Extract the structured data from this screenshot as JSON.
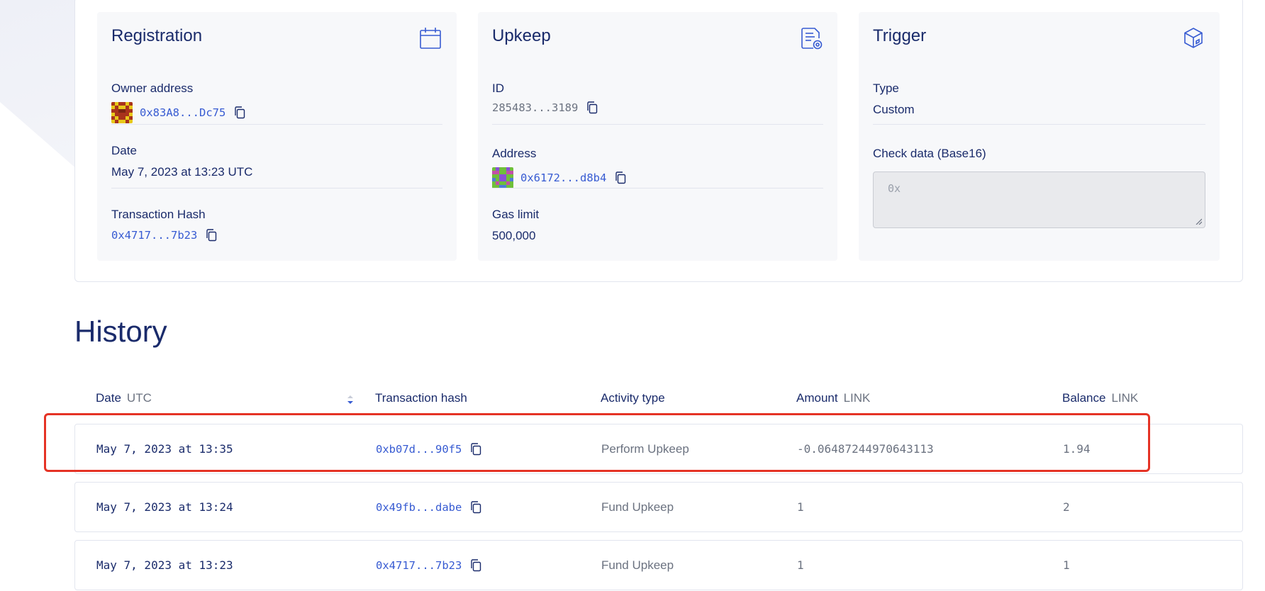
{
  "registration": {
    "title": "Registration",
    "owner_label": "Owner address",
    "owner_address": "0x83A8...Dc75",
    "date_label": "Date",
    "date_value": "May 7, 2023 at 13:23 UTC",
    "tx_label": "Transaction Hash",
    "tx_hash": "0x4717...7b23",
    "icon": "calendar-icon"
  },
  "upkeep": {
    "title": "Upkeep",
    "id_label": "ID",
    "id_value": "285483...3189",
    "address_label": "Address",
    "address_value": "0x6172...d8b4",
    "gas_label": "Gas limit",
    "gas_value": "500,000",
    "icon": "document-settings-icon"
  },
  "trigger": {
    "title": "Trigger",
    "type_label": "Type",
    "type_value": "Custom",
    "check_label": "Check data (Base16)",
    "check_placeholder": "0x",
    "icon": "cube-icon"
  },
  "history": {
    "title": "History",
    "columns": {
      "date": "Date",
      "date_unit": "UTC",
      "tx": "Transaction hash",
      "activity": "Activity type",
      "amount": "Amount",
      "amount_unit": "LINK",
      "balance": "Balance",
      "balance_unit": "LINK"
    },
    "rows": [
      {
        "date": "May 7, 2023 at 13:35",
        "tx": "0xb07d...90f5",
        "activity": "Perform Upkeep",
        "amount": "-0.06487244970643113",
        "balance": "1.94"
      },
      {
        "date": "May 7, 2023 at 13:24",
        "tx": "0x49fb...dabe",
        "activity": "Fund Upkeep",
        "amount": "1",
        "balance": "2"
      },
      {
        "date": "May 7, 2023 at 13:23",
        "tx": "0x4717...7b23",
        "activity": "Fund Upkeep",
        "amount": "1",
        "balance": "1"
      }
    ]
  },
  "colors": {
    "accent": "#375bd2",
    "title": "#1a2b6b",
    "highlight": "#e53325"
  }
}
